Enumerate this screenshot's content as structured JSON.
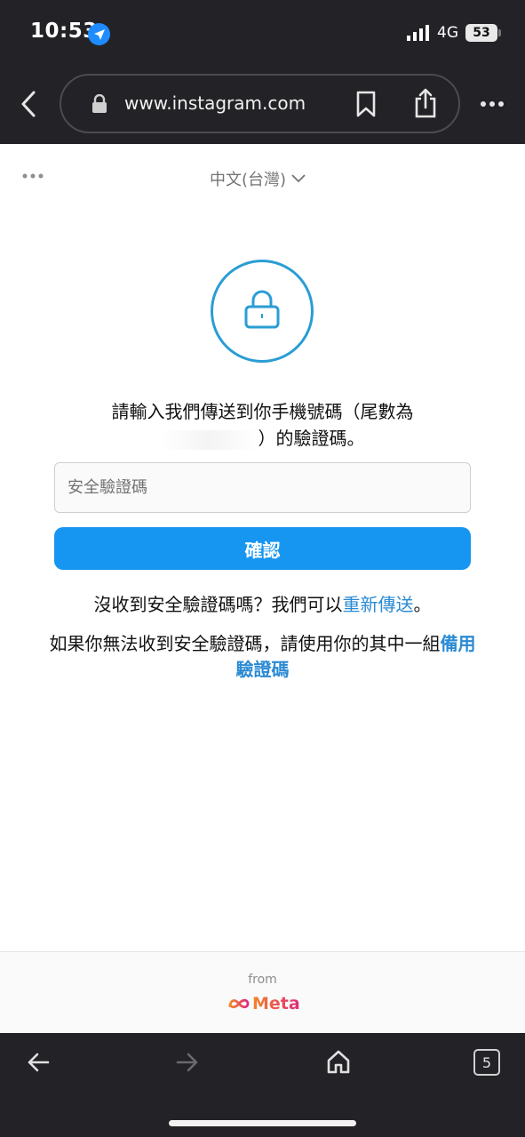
{
  "status_bar": {
    "time": "10:53",
    "network": "4G",
    "battery": "53"
  },
  "browser": {
    "url": "www.instagram.com",
    "tab_count": "5"
  },
  "page": {
    "language": "中文(台灣)",
    "instruction_line1": "請輸入我們傳送到你手機號碼（尾數為",
    "instruction_line2_suffix": "）的驗證碼。",
    "code_placeholder": "安全驗證碼",
    "confirm_label": "確認",
    "resend_prefix": "沒收到安全驗證碼嗎？我們可以",
    "resend_link": "重新傳送",
    "resend_suffix": "。",
    "backup_prefix": "如果你無法收到安全驗證碼，請使用你的其中一組",
    "backup_link": "備用驗證碼"
  },
  "footer": {
    "from": "from",
    "brand": "Meta"
  },
  "colors": {
    "accent": "#1796f1",
    "link": "#2a8ad4",
    "chrome": "#232327"
  }
}
